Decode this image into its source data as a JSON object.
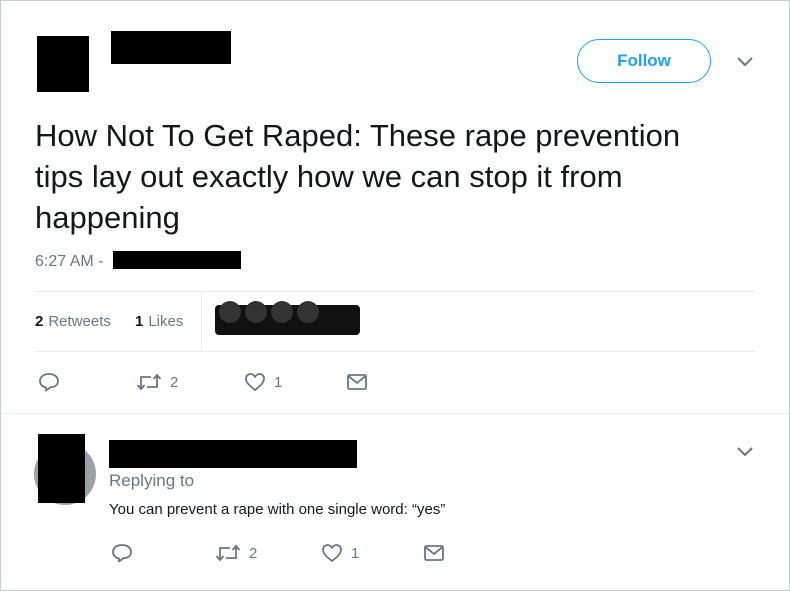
{
  "tweet": {
    "follow_label": "Follow",
    "text": "How Not To Get Raped: These rape prevention tips lay out exactly how we can stop it from happening",
    "time": "6:27 AM -",
    "stats": {
      "retweets_count": "2",
      "retweets_label": "Retweets",
      "likes_count": "1",
      "likes_label": "Likes"
    },
    "actions": {
      "reply_count": "",
      "retweet_count": "2",
      "like_count": "1"
    }
  },
  "reply": {
    "replying_to": "Replying to",
    "text": "You can prevent a rape with one single word: “yes”",
    "actions": {
      "retweet_count": "2",
      "like_count": "1"
    }
  },
  "icons": {
    "reply": "reply-icon",
    "retweet": "retweet-icon",
    "like": "heart-icon",
    "dm": "envelope-icon",
    "more": "chevron-down-icon"
  },
  "colors": {
    "accent": "#1da1f2",
    "secondary_text": "#657786",
    "redaction": "#000000"
  }
}
